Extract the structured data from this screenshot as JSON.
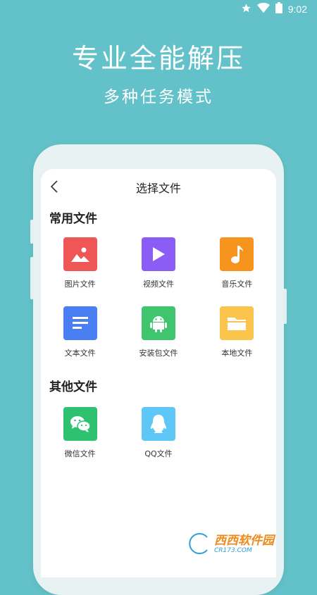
{
  "status_bar": {
    "time": "9:02"
  },
  "promo": {
    "headline": "专业全能解压",
    "subline": "多种任务模式"
  },
  "screen": {
    "title": "选择文件",
    "common_section": {
      "title": "常用文件",
      "items": [
        {
          "label": "图片文件",
          "icon": "image-icon",
          "color": "#ef5656"
        },
        {
          "label": "视频文件",
          "icon": "play-icon",
          "color": "#8b5cf6"
        },
        {
          "label": "音乐文件",
          "icon": "music-note-icon",
          "color": "#f7941d"
        },
        {
          "label": "文本文件",
          "icon": "text-lines-icon",
          "color": "#4a7ef3"
        },
        {
          "label": "安装包文件",
          "icon": "android-icon",
          "color": "#3ec56d"
        },
        {
          "label": "本地文件",
          "icon": "folder-icon",
          "color": "#fbc44d"
        }
      ]
    },
    "other_section": {
      "title": "其他文件",
      "items": [
        {
          "label": "微信文件",
          "icon": "wechat-icon",
          "color": "#2ec270"
        },
        {
          "label": "QQ文件",
          "icon": "qq-penguin-icon",
          "color": "#5ec7f7"
        }
      ]
    }
  },
  "watermark": {
    "text": "西西软件园",
    "sub": "CR173.COM"
  }
}
